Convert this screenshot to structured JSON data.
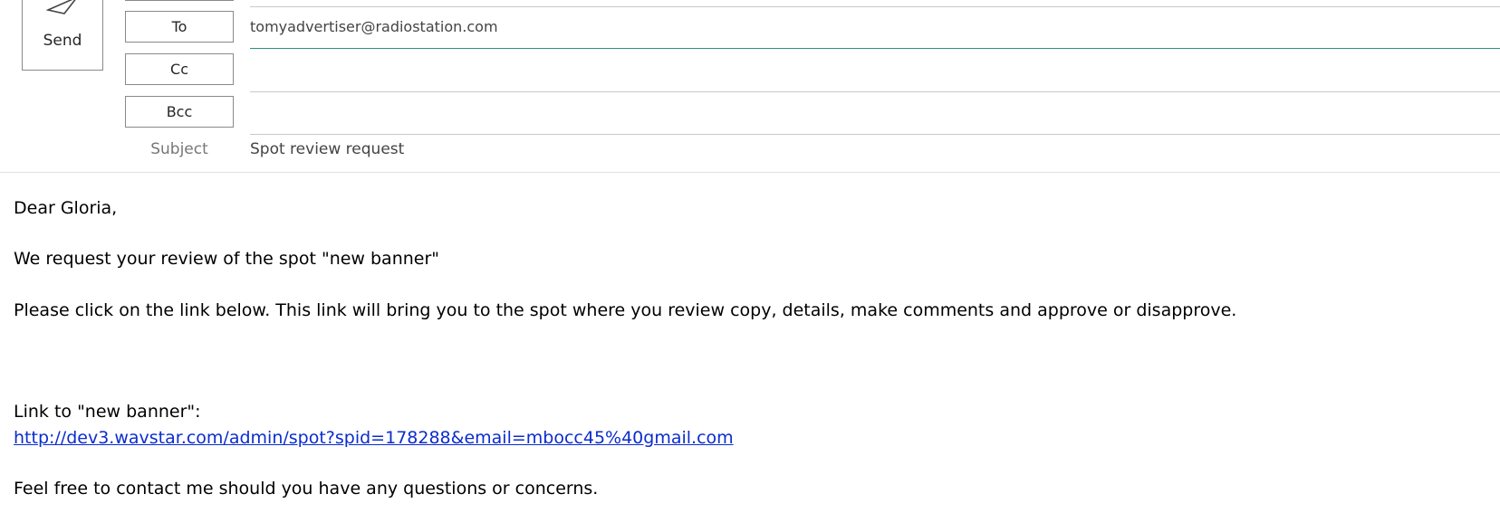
{
  "toolbar": {
    "send_label": "Send"
  },
  "recipients": {
    "to_label": "To",
    "to_value": "tomyadvertiser@radiostation.com",
    "cc_label": "Cc",
    "cc_value": "",
    "bcc_label": "Bcc",
    "bcc_value": ""
  },
  "subject": {
    "label": "Subject",
    "value": "Spot review request"
  },
  "body": {
    "greeting": "Dear Gloria,",
    "line1": "We request your review of the spot \"new banner\"",
    "line2": "Please click on the link below. This link will bring you to the spot where you review copy, details, make comments and approve or disapprove.",
    "link_label": "Link to \"new banner\":",
    "link_url": "http://dev3.wavstar.com/admin/spot?spid=178288&email=mbocc45%40gmail.com",
    "closing": "Feel free to contact me should you have any questions or concerns."
  },
  "colors": {
    "active_underline": "#2a8f86",
    "link": "#0b2ccf"
  }
}
